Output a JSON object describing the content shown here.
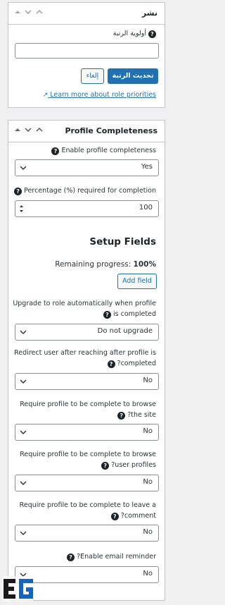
{
  "publish_box": {
    "title": "نشر",
    "priority_label": "أولوية الرتبة",
    "priority_value": "",
    "update_button": "تحديث الرتبة",
    "cancel_button": "إلغاء",
    "learn_more": "Learn more about role priorities"
  },
  "profile_box": {
    "title": "Profile Completeness",
    "enable_label": "Enable profile completeness",
    "enable_value": "Yes",
    "percentage_label": "Percentage (%) required for completion",
    "percentage_value": "100",
    "setup_heading": "Setup Fields",
    "remaining_label": "Remaining progress:",
    "remaining_value": "100%",
    "add_field_button": "Add field",
    "upgrade_label_1": "Upgrade to role automatically when profile",
    "upgrade_label_2": "is completed",
    "upgrade_value": "Do not upgrade",
    "redirect_label_1": "Redirect user after reaching after profile is",
    "redirect_label_2": "?completed",
    "redirect_value": "No",
    "browse_site_label_1": "Require profile to be complete to browse",
    "browse_site_label_2": "?the site",
    "browse_site_value": "No",
    "browse_profiles_label_1": "Require profile to be complete to browse",
    "browse_profiles_label_2": "?user profiles",
    "browse_profiles_value": "No",
    "comment_label_1": "Require profile to be complete to leave a",
    "comment_label_2": "?comment",
    "comment_value": "No",
    "email_label": "?Enable email reminder",
    "email_value": "No"
  },
  "logo_text": "EG",
  "colors": {
    "accent": "#2271b1",
    "border": "#c3c4c7",
    "background": "#f0f0f1"
  }
}
